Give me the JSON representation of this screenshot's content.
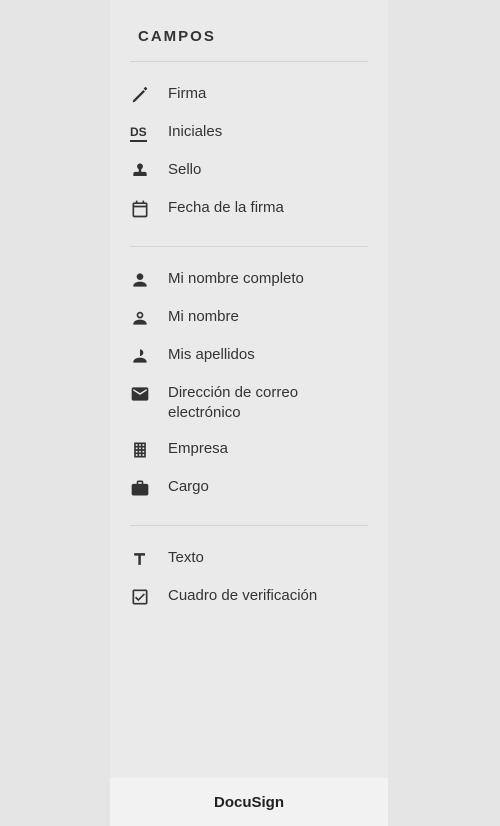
{
  "heading": "CAMPOS",
  "groups": [
    {
      "items": [
        {
          "label": "Firma"
        },
        {
          "label": "Iniciales"
        },
        {
          "label": "Sello"
        },
        {
          "label": "Fecha de la firma"
        }
      ]
    },
    {
      "items": [
        {
          "label": "Mi nombre completo"
        },
        {
          "label": "Mi nombre"
        },
        {
          "label": "Mis apellidos"
        },
        {
          "label": "Dirección de correo electrónico"
        },
        {
          "label": "Empresa"
        },
        {
          "label": "Cargo"
        }
      ]
    },
    {
      "items": [
        {
          "label": "Texto"
        },
        {
          "label": "Cuadro de verificación"
        }
      ]
    }
  ],
  "footer": {
    "brand": "DocuSign"
  }
}
